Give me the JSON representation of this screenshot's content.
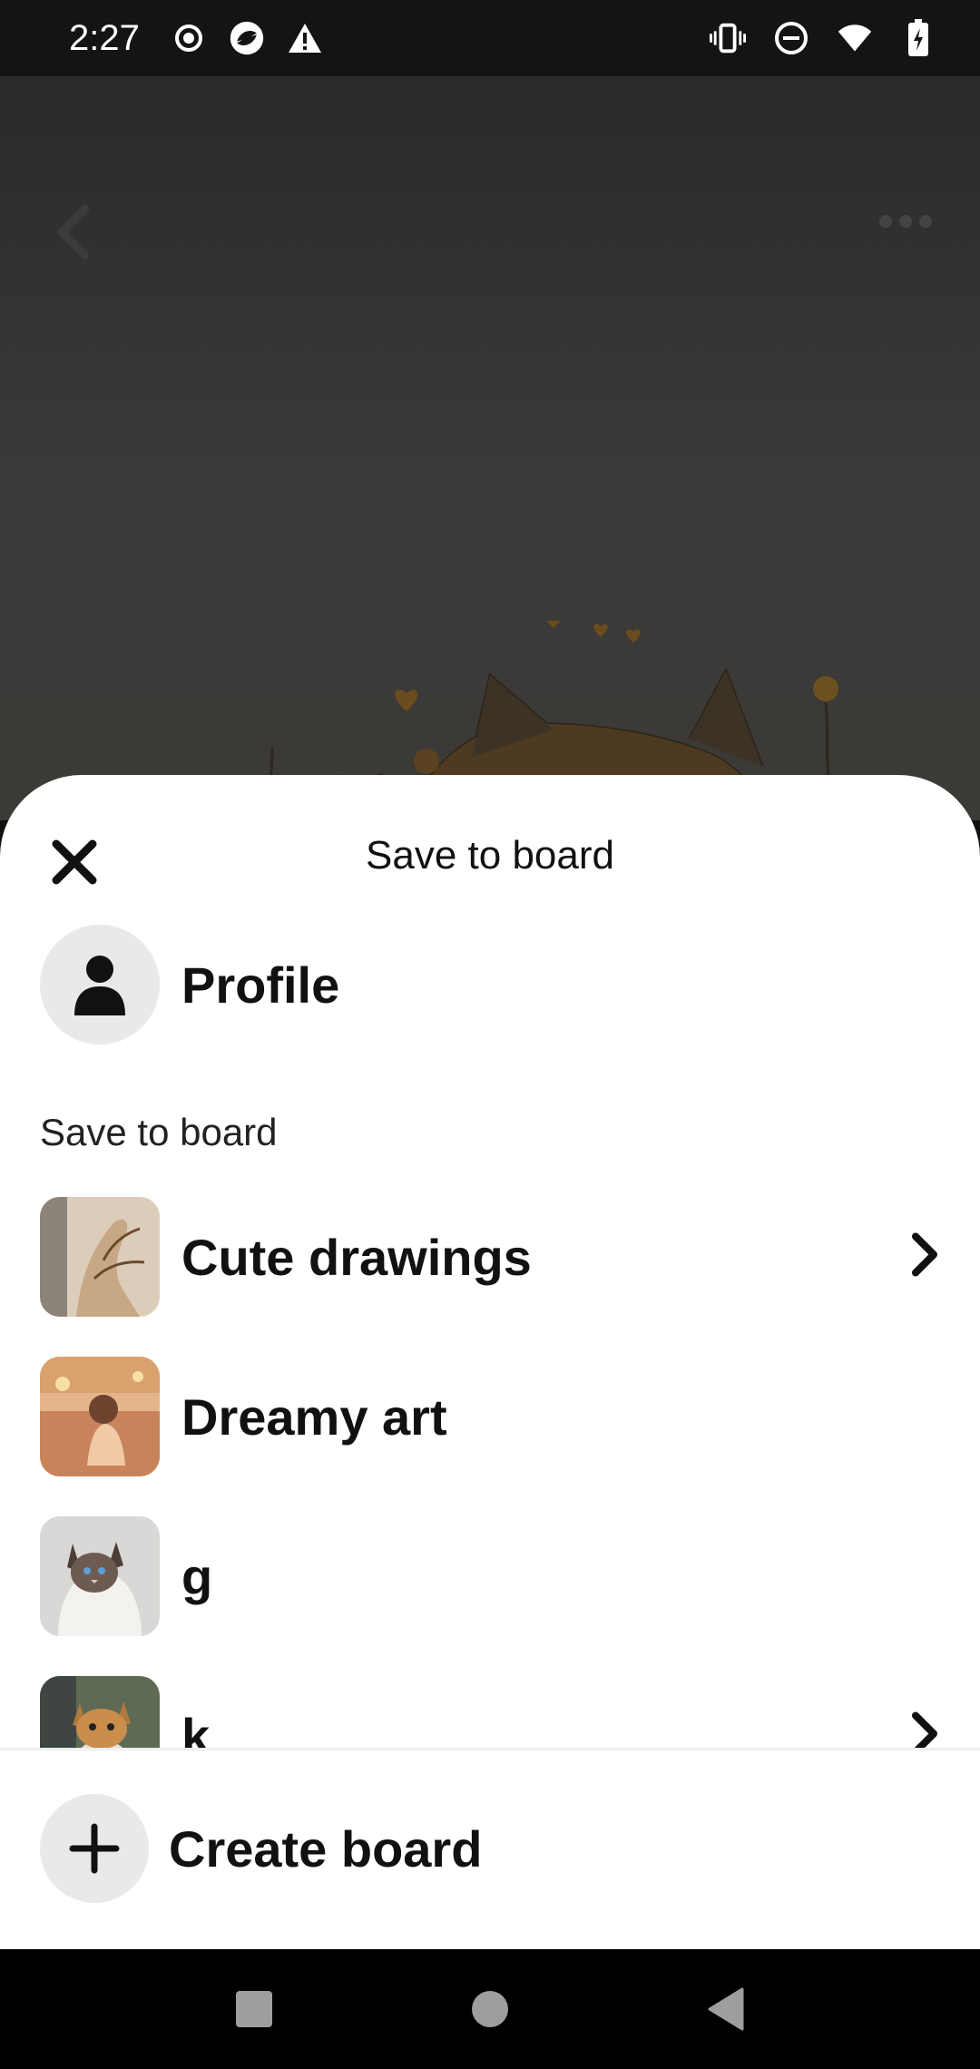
{
  "status_bar": {
    "time": "2:27",
    "left_icons": [
      "record-icon",
      "app-icon",
      "warning-icon"
    ],
    "right_icons": [
      "vibrate-icon",
      "do-not-disturb-icon",
      "wifi-icon",
      "battery-charging-icon"
    ]
  },
  "pin_view": {
    "back_icon": "chevron-left-icon",
    "more_icon": "more-horizontal-icon"
  },
  "sheet": {
    "title": "Save to board",
    "close_icon": "close-icon",
    "profile": {
      "name": "Profile",
      "icon": "person-icon"
    },
    "section_label": "Save to board",
    "boards": [
      {
        "name": "Cute drawings",
        "has_chevron": true
      },
      {
        "name": "Dreamy art",
        "has_chevron": false
      },
      {
        "name": "g",
        "has_chevron": false
      },
      {
        "name": "k",
        "has_chevron": true
      }
    ],
    "create_board": {
      "label": "Create board",
      "icon": "plus-icon"
    }
  },
  "nav_bar": {
    "buttons": [
      "recents-square-icon",
      "home-circle-icon",
      "back-triangle-icon"
    ]
  },
  "colors": {
    "sheet_bg": "#ffffff",
    "text": "#111111",
    "icon_circle_bg": "#e9e9e9",
    "scrim": "#2f2f2f",
    "nav_bg": "#000000"
  }
}
